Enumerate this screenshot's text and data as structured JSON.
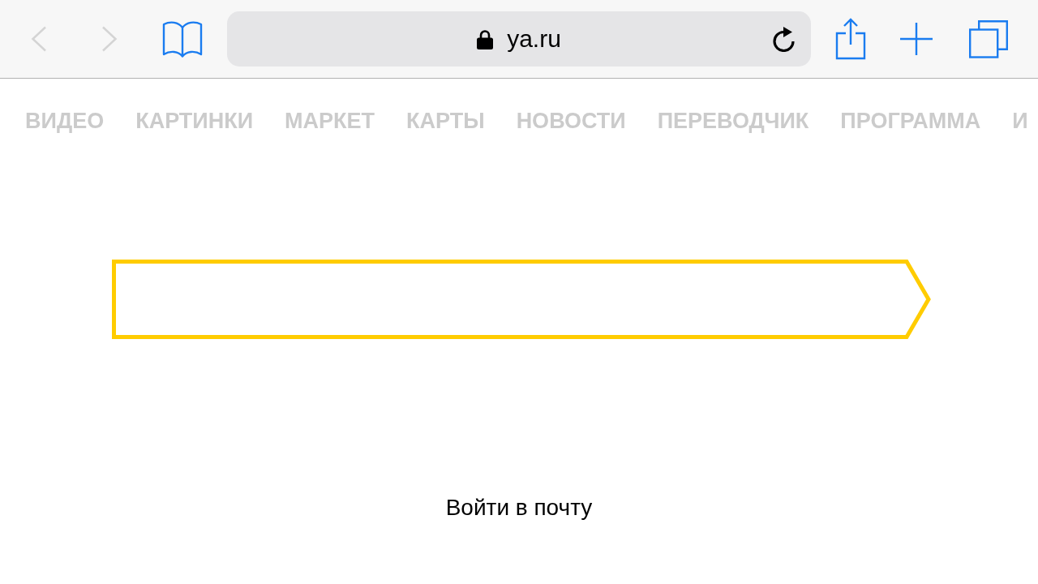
{
  "toolbar": {
    "back": {
      "disabled": true
    },
    "forward": {
      "disabled": true
    }
  },
  "address_bar": {
    "secure": true,
    "url": "ya.ru"
  },
  "nav_links": [
    "ВИДЕО",
    "КАРТИНКИ",
    "МАРКЕТ",
    "КАРТЫ",
    "НОВОСТИ",
    "ПЕРЕВОДЧИК",
    "ПРОГРАММА",
    "И"
  ],
  "mail_link": "Войти в почту"
}
